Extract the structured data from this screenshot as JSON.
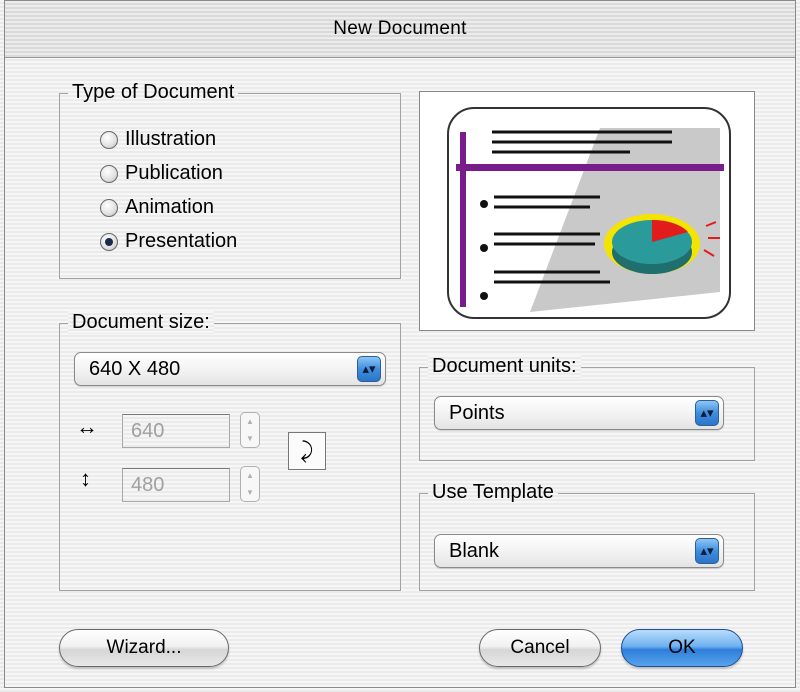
{
  "window": {
    "title": "New Document"
  },
  "type_group": {
    "legend": "Type of Document",
    "options": [
      "Illustration",
      "Publication",
      "Animation",
      "Presentation"
    ],
    "selected": "Presentation"
  },
  "size_group": {
    "legend": "Document size:",
    "selected": "640 X 480",
    "width": "640",
    "height": "480"
  },
  "units_group": {
    "legend": "Document units:",
    "selected": "Points"
  },
  "template_group": {
    "legend": "Use Template",
    "selected": "Blank"
  },
  "buttons": {
    "wizard": "Wizard...",
    "cancel": "Cancel",
    "ok": "OK"
  },
  "colors": {
    "accent": "#3e8ee0",
    "preview_line": "#7a1d8c",
    "pie": "#2a9a9a",
    "pie_slice": "#e21b1b",
    "pie_ring": "#f5e400"
  }
}
